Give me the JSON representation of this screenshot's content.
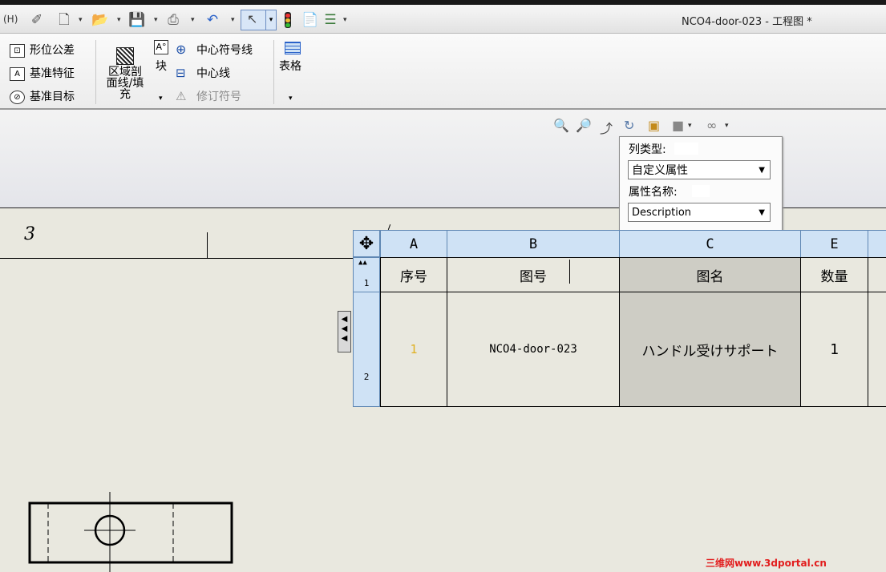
{
  "window": {
    "title": "NCO4-door-023 - 工程图 *",
    "menu_fragment": "(H)"
  },
  "ribbon": {
    "col1": [
      "形位公差",
      "基准特征",
      "基准目标"
    ],
    "col1_icons": [
      "geometric-tolerance-icon",
      "datum-feature-icon",
      "datum-target-icon"
    ],
    "area_hatch": [
      "区域剖",
      "面线/填",
      "充"
    ],
    "block": "块",
    "col3": [
      "中心符号线",
      "中心线",
      "修订符号"
    ],
    "table": "表格"
  },
  "popup": {
    "column_type_label": "列类型:",
    "column_type_value": "自定义属性",
    "property_name_label": "属性名称:",
    "property_name_value": "Description"
  },
  "title_block": {
    "fragment": "3"
  },
  "bom": {
    "columns": [
      "A",
      "B",
      "C",
      "E"
    ],
    "header_row_num": "1",
    "headers": [
      "序号",
      "图号",
      "图名",
      "数量"
    ],
    "data_row_num": "2",
    "row": [
      "1",
      "NCO4-door-023",
      "ハンドル受けサポート",
      "1"
    ]
  },
  "watermark": "三维网www.3dportal.cn",
  "colors": {
    "sheet_bg": "#e9e8df",
    "header_blue": "#cfe2f5",
    "selected_column": "#cecdc5",
    "watermark_red": "#e21d1d"
  }
}
